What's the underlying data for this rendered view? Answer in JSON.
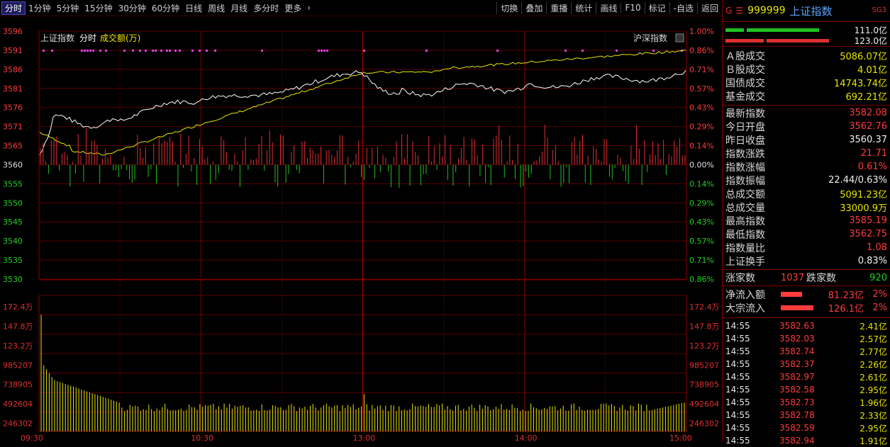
{
  "toolbar": {
    "periods": [
      "分时",
      "1分钟",
      "5分钟",
      "15分钟",
      "30分钟",
      "60分钟",
      "日线",
      "周线",
      "月线",
      "多分时",
      "更多"
    ],
    "active_period": "分时",
    "tools": [
      "切换",
      "叠加",
      "重播",
      "统计",
      "画线",
      "F10",
      "标记",
      "-自选",
      "返回"
    ]
  },
  "chart_labels": {
    "index_name": "上证指数",
    "mode": "分时",
    "amount_label": "成交额(万)",
    "compare_label": "沪深指数"
  },
  "chart_data": {
    "type": "line",
    "price_axis": {
      "ticks": [
        3596,
        3591,
        3586,
        3581,
        3576,
        3571,
        3565,
        3560,
        3555,
        3550,
        3545,
        3540,
        3535,
        3530
      ],
      "pct_ticks": [
        "1.00%",
        "0.86%",
        "0.71%",
        "0.57%",
        "0.43%",
        "0.29%",
        "0.14%",
        "0.00%",
        "0.14%",
        "0.29%",
        "0.43%",
        "0.57%",
        "0.71%",
        "0.86%"
      ],
      "prev_close": 3560.37
    },
    "volume_axis": {
      "ticks": [
        "172.4万",
        "147.8万",
        "123.2万",
        "985207",
        "738905",
        "492604",
        "246302"
      ]
    },
    "x_ticks": [
      "09:30",
      "10:30",
      "13:00",
      "14:00",
      "15:00"
    ],
    "series": [
      {
        "name": "上证指数",
        "color": "#ffffff"
      },
      {
        "name": "均价",
        "color": "#e6e600"
      }
    ]
  },
  "panel": {
    "code": "999999",
    "name": "上证指数",
    "badge": "SG3",
    "bar_values": [
      "111.0亿",
      "123.0亿"
    ],
    "stats": [
      {
        "label": "Ａ股成交",
        "value": "5086.07亿",
        "color": "y"
      },
      {
        "label": "Ｂ股成交",
        "value": "4.01亿",
        "color": "y"
      },
      {
        "label": "国债成交",
        "value": "14743.74亿",
        "color": "y"
      },
      {
        "label": "基金成交",
        "value": "692.21亿",
        "color": "y"
      }
    ],
    "index_stats": [
      {
        "label": "最新指数",
        "value": "3582.08",
        "color": "r"
      },
      {
        "label": "今日开盘",
        "value": "3562.76",
        "color": "r"
      },
      {
        "label": "昨日收盘",
        "value": "3560.37",
        "color": "w"
      },
      {
        "label": "指数涨跌",
        "value": "21.71",
        "color": "r"
      },
      {
        "label": "指数涨幅",
        "value": "0.61%",
        "color": "r"
      },
      {
        "label": "指数振幅",
        "value": "22.44/0.63%",
        "color": "w"
      },
      {
        "label": "总成交额",
        "value": "5091.23亿",
        "color": "y"
      },
      {
        "label": "总成交量",
        "value": "33000.9万",
        "color": "y"
      },
      {
        "label": "最高指数",
        "value": "3585.19",
        "color": "r"
      },
      {
        "label": "最低指数",
        "value": "3562.75",
        "color": "r"
      },
      {
        "label": "指数量比",
        "value": "1.08",
        "color": "r"
      },
      {
        "label": "上证换手",
        "value": "0.83%",
        "color": "w"
      }
    ],
    "breadth": {
      "up_label": "涨家数",
      "up": "1037",
      "down_label": "跌家数",
      "down": "920"
    },
    "flows": [
      {
        "label": "净流入额",
        "value": "81.23亿",
        "pct": "2%"
      },
      {
        "label": "大宗流入",
        "value": "126.1亿",
        "pct": "2%"
      }
    ],
    "trades": [
      {
        "time": "14:55",
        "price": "3582.63",
        "vol": "2.41亿"
      },
      {
        "time": "14:55",
        "price": "3582.03",
        "vol": "2.57亿"
      },
      {
        "time": "14:55",
        "price": "3582.74",
        "vol": "2.77亿"
      },
      {
        "time": "14:55",
        "price": "3582.37",
        "vol": "2.26亿"
      },
      {
        "time": "14:55",
        "price": "3582.97",
        "vol": "2.61亿"
      },
      {
        "time": "14:55",
        "price": "3582.58",
        "vol": "2.95亿"
      },
      {
        "time": "14:55",
        "price": "3582.73",
        "vol": "1.96亿"
      },
      {
        "time": "14:55",
        "price": "3582.78",
        "vol": "2.33亿"
      },
      {
        "time": "14:55",
        "price": "3582.59",
        "vol": "2.95亿"
      },
      {
        "time": "14:55",
        "price": "3582.94",
        "vol": "1.91亿"
      }
    ]
  }
}
